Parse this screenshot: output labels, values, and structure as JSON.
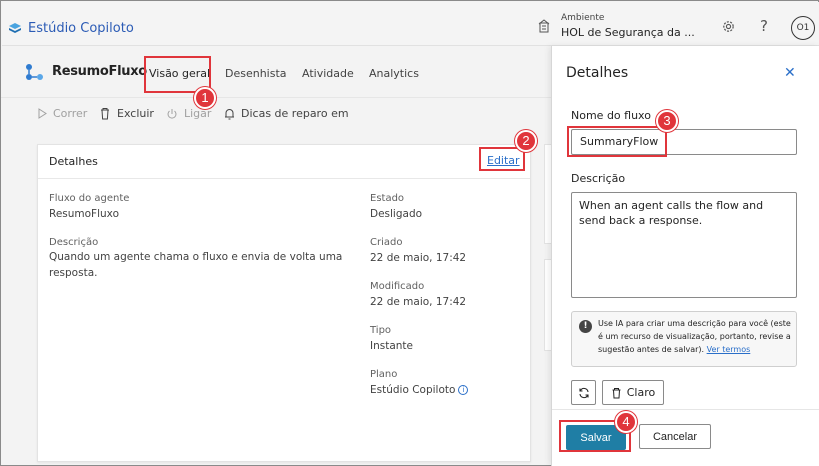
{
  "app": {
    "title": "Estúdio Copiloto"
  },
  "environment": {
    "label": "Ambiente",
    "value": "HOL de Segurança da ..."
  },
  "header": {
    "avatar": "O1",
    "help": "?"
  },
  "flow": {
    "name": "ResumoFluxo"
  },
  "tabs": [
    {
      "label": "Visão geral",
      "active": true
    },
    {
      "label": "Desenhista",
      "active": false
    },
    {
      "label": "Atividade",
      "active": false
    },
    {
      "label": "Analytics",
      "active": false
    }
  ],
  "commands": {
    "run": "Correr",
    "delete": "Excluir",
    "turn_on": "Ligar",
    "repair_tips": "Dicas de reparo em"
  },
  "details_card": {
    "title": "Detalhes",
    "edit": "Editar",
    "agent_flow_label": "Fluxo do agente",
    "agent_flow_value": "ResumoFluxo",
    "description_label": "Descrição",
    "description_value": "Quando um agente chama o fluxo e envia de volta uma resposta.",
    "state_label": "Estado",
    "state_value": "Desligado",
    "created_label": "Criado",
    "created_value": "22 de maio, 17:42",
    "modified_label": "Modificado",
    "modified_value": "22 de maio, 17:42",
    "type_label": "Tipo",
    "type_value": "Instante",
    "plan_label": "Plano",
    "plan_value": "Estúdio Copiloto"
  },
  "panel": {
    "title": "Detalhes",
    "close": "✕",
    "name_label": "Nome do fluxo",
    "name_value": "SummaryFlow",
    "description_label": "Descrição",
    "description_value": "When an agent calls the flow and send back a response.",
    "ai_note": "Use IA para criar uma descrição para você (este é um recurso de visualização, portanto, revise a sugestão antes de salvar).",
    "ai_link": "Ver termos",
    "clear": "Claro",
    "save": "Salvar",
    "cancel": "Cancelar"
  },
  "annotations": [
    "1",
    "2",
    "3",
    "4"
  ],
  "colors": {
    "accent": "#2a6fc9",
    "primary_button": "#1f7ea5",
    "annotation": "#e0353b"
  }
}
